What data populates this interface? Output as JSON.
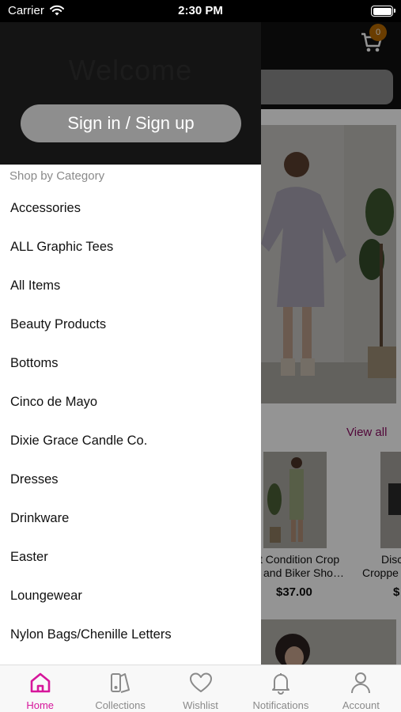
{
  "status_bar": {
    "carrier": "Carrier",
    "time": "2:30 PM"
  },
  "background": {
    "cart_count": "0",
    "view_all": "View all",
    "products": [
      {
        "title_line1": "t Condition Crop",
        "title_line2": "and Biker Sho…",
        "price": "$37.00"
      },
      {
        "title_line1": "Disco",
        "title_line2": "Croppe",
        "price": "$"
      }
    ]
  },
  "drawer": {
    "welcome": "Welcome",
    "signin_label": "Sign in / Sign up",
    "category_heading": "Shop by Category",
    "categories": [
      "Accessories",
      "ALL Graphic Tees",
      "All Items",
      "Beauty Products",
      "Bottoms",
      "Cinco de Mayo",
      "Dixie Grace Candle Co.",
      "Dresses",
      "Drinkware",
      "Easter",
      "Loungewear",
      "Nylon Bags/Chenille Letters"
    ]
  },
  "tab_bar": {
    "active_color": "#d6169b",
    "tabs": [
      {
        "label": "Home",
        "icon": "home-icon",
        "active": true
      },
      {
        "label": "Collections",
        "icon": "collections-icon",
        "active": false
      },
      {
        "label": "Wishlist",
        "icon": "heart-icon",
        "active": false
      },
      {
        "label": "Notifications",
        "icon": "bell-icon",
        "active": false
      },
      {
        "label": "Account",
        "icon": "person-icon",
        "active": false
      }
    ]
  }
}
